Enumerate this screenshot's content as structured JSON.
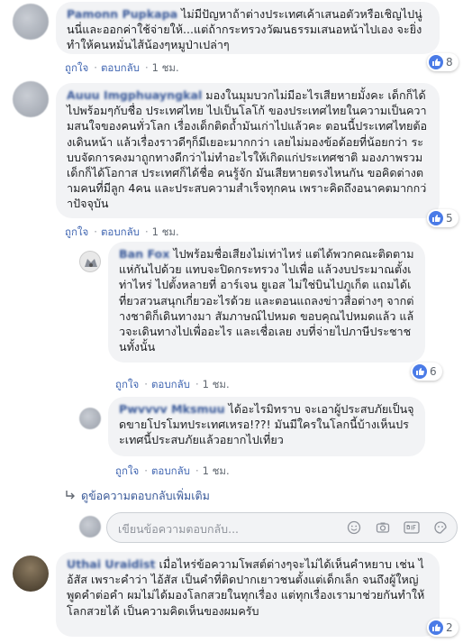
{
  "comments": [
    {
      "author": "Pamonn Pupkapa",
      "text": "ไม่มีปัญหาถ้าต่างประเทศเค้าเสนอตัวหรือเชิญไปนู่นนี่และออกค่าใช้จ่ายให้...แต่ถ้ากระทรวงวัฒนธรรมเสนอหน้าไปเอง จะยิ่งทำให้คนหมั่นไส้น้องๆหมูป่าเปล่าๆ",
      "like": "ถูกใจ",
      "reply": "ตอบกลับ",
      "time": "1 ชม.",
      "reactions": "8"
    },
    {
      "author": "Auuu Imgphuayngkal",
      "text": "มองในมุมบวกไม่มีอะไรเสียหายมั้งคะ เด็กก็ได้ไปพร้อมๆกับชื่อ ประเทศไทย ไปเป็นโลโก้ ของประเทศไทยในความเป็นความสนใจของคนทั่วโลก เรื่องเด็กติดถ้ำมันเก่าไปแล้วคะ ตอนนี้ประเทศไทยต้องเดินหน้า แล้วเรื่องราวดีๆก็มีเยอะมากกว่า เลยไม่มองข้อด้อยที่น้อยกว่า ระบบจัดการคงมาถูกทางดีกว่าไม่ทำอะไรให้เกิดแก่ประเทศชาติ มองภาพรวม เด็กก็ได้โอกาส ประเทศก็ได้ชื่อ คนรู้จัก มันเสียหายตรงไหนกัน ขอคิดต่างตามคนที่มีลูก 4คน และประสบความสำเร็จทุกคน เพราะคิดถึงอนาคตมากกว่าปัจจุบัน",
      "like": "ถูกใจ",
      "reply": "ตอบกลับ",
      "time": "1 ชม.",
      "reactions": "5"
    }
  ],
  "replies": [
    {
      "author": "Ban Fox",
      "text": "ไปพร้อมชื่อเสียงไม่เท่าไหร่ แต่ได้พวกคณะติดตามแห่กันไปด้วย แทบจะปิดกระทรวง ไปเพื่อ แล้วงบประมาณตั้งเท่าไหร่ ไปตั้งหลายที่ อาร์เจน ยูเอส ไม่ใช่บินไปภูเก็ต แถมได้เที่ยวสวนสนุกเกี่ยวอะไรด้วย และตอนแถลงข่าวสื่อต่างๆ จากต่างชาติก็เดินทางมา สัมภาษณ์ไปหมด ขอบคุณไปหมดแล้ว แล้วจะเดินทางไปเพื่ออะไร และเชื่อเลย งบที่จ่ายไปภาษีประชาชนทั้งนั้น",
      "like": "ถูกใจ",
      "reply": "ตอบกลับ",
      "time": "1 ชม.",
      "reactions": "6"
    },
    {
      "author": "Pwvvvv Mksmuu",
      "text": "ได้อะไรมิทราบ จะเอาผู้ประสบภัยเป็นจุดขายโปรโมทประเทศเหรอ!??! มันมีใครในโลกนี้บ้างเห็นประเทศนี้ประสบภัยแล้วอยากไปเที่ยว",
      "like": "ถูกใจ",
      "reply": "ตอบกลับ",
      "time": "1 ชม."
    }
  ],
  "more_replies": "ดูข้อความตอบกลับเพิ่มเติม",
  "reply_box": {
    "placeholder": "เขียนข้อความตอบกลับ..."
  },
  "last_comment": {
    "author": "Uthai Uraidist",
    "text": "เมื่อไหร่ข้อความโพสต์ต่างๆจะไม่ได้เห็นคำหยาบ เช่น ไอ้สัส เพราะคำว่า ไอ้สัส เป็นคำที่ติดปากเยาวชนตั้งแต่เด็กเล็ก จนถึงผู้ใหญ่ พูดคำต่อคำ ผมไม่ได้มองโลกสวยในทุกเรื่อง แต่ทุกเรื่องเรามาช่วยกันทำให้โลกสวยได้ เป็นความคิดเห็นของผมครับ",
    "reactions": "2"
  },
  "colors": {
    "link": "#4267b2",
    "author": "#385898",
    "bubble": "#f2f3f5",
    "like_badge": "#4a7be7"
  }
}
